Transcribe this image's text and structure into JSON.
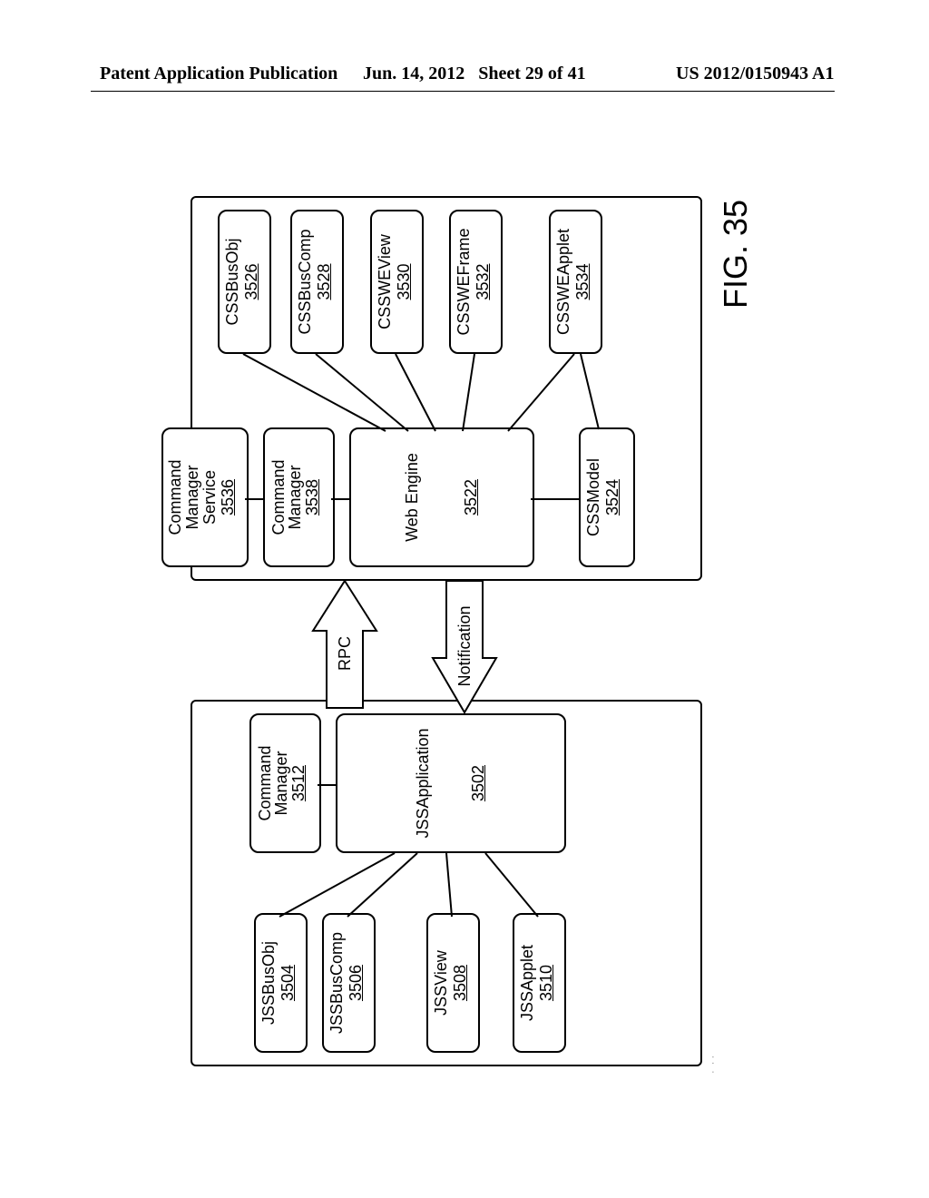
{
  "header": {
    "left_label": "Patent Application Publication",
    "date": "Jun. 14, 2012",
    "sheet": "Sheet 29 of 41",
    "pubno": "US 2012/0150943 A1"
  },
  "figure": {
    "label": "FIG. 35"
  },
  "left_outer_box": "client-side-container",
  "right_outer_box": "server-side-container",
  "blocks": {
    "jss_bus_obj": {
      "title": "JSSBusObj",
      "num": "3504"
    },
    "jss_bus_comp": {
      "title": "JSSBusComp",
      "num": "3506"
    },
    "jss_view": {
      "title": "JSSView",
      "num": "3508"
    },
    "jss_applet": {
      "title": "JSSApplet",
      "num": "3510"
    },
    "jss_cmd_mgr": {
      "title": "Command\nManager",
      "num": "3512"
    },
    "jss_app": {
      "title": "JSSApplication",
      "num": "3502"
    },
    "svc_cmd_mgr_svc": {
      "title": "Command\nManager\nService",
      "num": "3536"
    },
    "svc_cmd_mgr": {
      "title": "Command\nManager",
      "num": "3538"
    },
    "web_engine": {
      "title": "Web Engine",
      "num": "3522"
    },
    "css_model": {
      "title": "CSSModel",
      "num": "3524"
    },
    "css_bus_obj": {
      "title": "CSSBusObj",
      "num": "3526"
    },
    "css_bus_comp": {
      "title": "CSSBusComp",
      "num": "3528"
    },
    "css_swe_view": {
      "title": "CSSWEView",
      "num": "3530"
    },
    "css_swe_frame": {
      "title": "CSSWEFrame",
      "num": "3532"
    },
    "css_swe_applet": {
      "title": "CSSWEApplet",
      "num": "3534"
    }
  },
  "arrows": {
    "rpc": "RPC",
    "notification": "Notification"
  },
  "chart_data": {
    "type": "diagram",
    "nodes": [
      {
        "id": "3504",
        "label": "JSSBusObj",
        "side": "client"
      },
      {
        "id": "3506",
        "label": "JSSBusComp",
        "side": "client"
      },
      {
        "id": "3508",
        "label": "JSSView",
        "side": "client"
      },
      {
        "id": "3510",
        "label": "JSSApplet",
        "side": "client"
      },
      {
        "id": "3512",
        "label": "Command Manager",
        "side": "client"
      },
      {
        "id": "3502",
        "label": "JSSApplication",
        "side": "client"
      },
      {
        "id": "3536",
        "label": "Command Manager Service",
        "side": "server"
      },
      {
        "id": "3538",
        "label": "Command Manager",
        "side": "server"
      },
      {
        "id": "3522",
        "label": "Web Engine",
        "side": "server"
      },
      {
        "id": "3524",
        "label": "CSSModel",
        "side": "server"
      },
      {
        "id": "3526",
        "label": "CSSBusObj",
        "side": "server"
      },
      {
        "id": "3528",
        "label": "CSSBusComp",
        "side": "server"
      },
      {
        "id": "3530",
        "label": "CSSWEView",
        "side": "server"
      },
      {
        "id": "3532",
        "label": "CSSWEFrame",
        "side": "server"
      },
      {
        "id": "3534",
        "label": "CSSWEApplet",
        "side": "server"
      }
    ],
    "edges": [
      {
        "from": "3502",
        "to": "3504"
      },
      {
        "from": "3502",
        "to": "3506"
      },
      {
        "from": "3502",
        "to": "3508"
      },
      {
        "from": "3502",
        "to": "3510"
      },
      {
        "from": "3512",
        "to": "3502"
      },
      {
        "from": "3536",
        "to": "3538"
      },
      {
        "from": "3538",
        "to": "3522"
      },
      {
        "from": "3522",
        "to": "3526"
      },
      {
        "from": "3522",
        "to": "3528"
      },
      {
        "from": "3522",
        "to": "3530"
      },
      {
        "from": "3522",
        "to": "3532"
      },
      {
        "from": "3522",
        "to": "3534"
      },
      {
        "from": "3522",
        "to": "3524"
      },
      {
        "from": "3524",
        "to": "3534"
      },
      {
        "from": "3502",
        "to": "3538",
        "label": "RPC",
        "type": "big-arrow",
        "dir": "client-to-server"
      },
      {
        "from": "3522",
        "to": "3502",
        "label": "Notification",
        "type": "big-arrow",
        "dir": "server-to-client"
      }
    ]
  }
}
